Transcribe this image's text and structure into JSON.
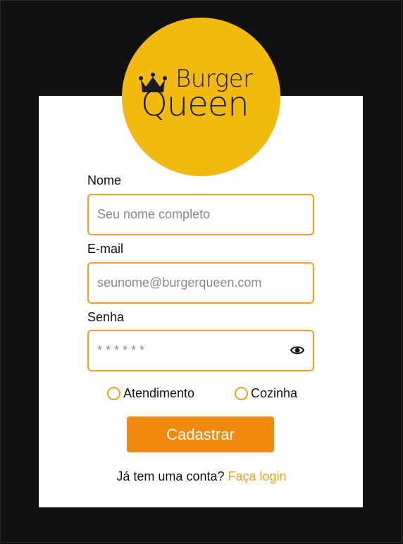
{
  "logo": {
    "line1": "Burger",
    "line2": "Queen"
  },
  "form": {
    "name": {
      "label": "Nome",
      "placeholder": "Seu nome completo"
    },
    "email": {
      "label": "E-mail",
      "placeholder": "seunome@burgerqueen.com"
    },
    "password": {
      "label": "Senha",
      "placeholder": "* * * * * *"
    },
    "roles": [
      {
        "label": "Atendimento"
      },
      {
        "label": "Cozinha"
      }
    ],
    "submit_label": "Cadastrar"
  },
  "footer": {
    "prompt": "Já tem uma conta?",
    "link": "Faça login"
  },
  "colors": {
    "background": "#111111",
    "logo_circle": "#f2b90f",
    "accent_border": "#f0a020",
    "button": "#f28a0f"
  }
}
